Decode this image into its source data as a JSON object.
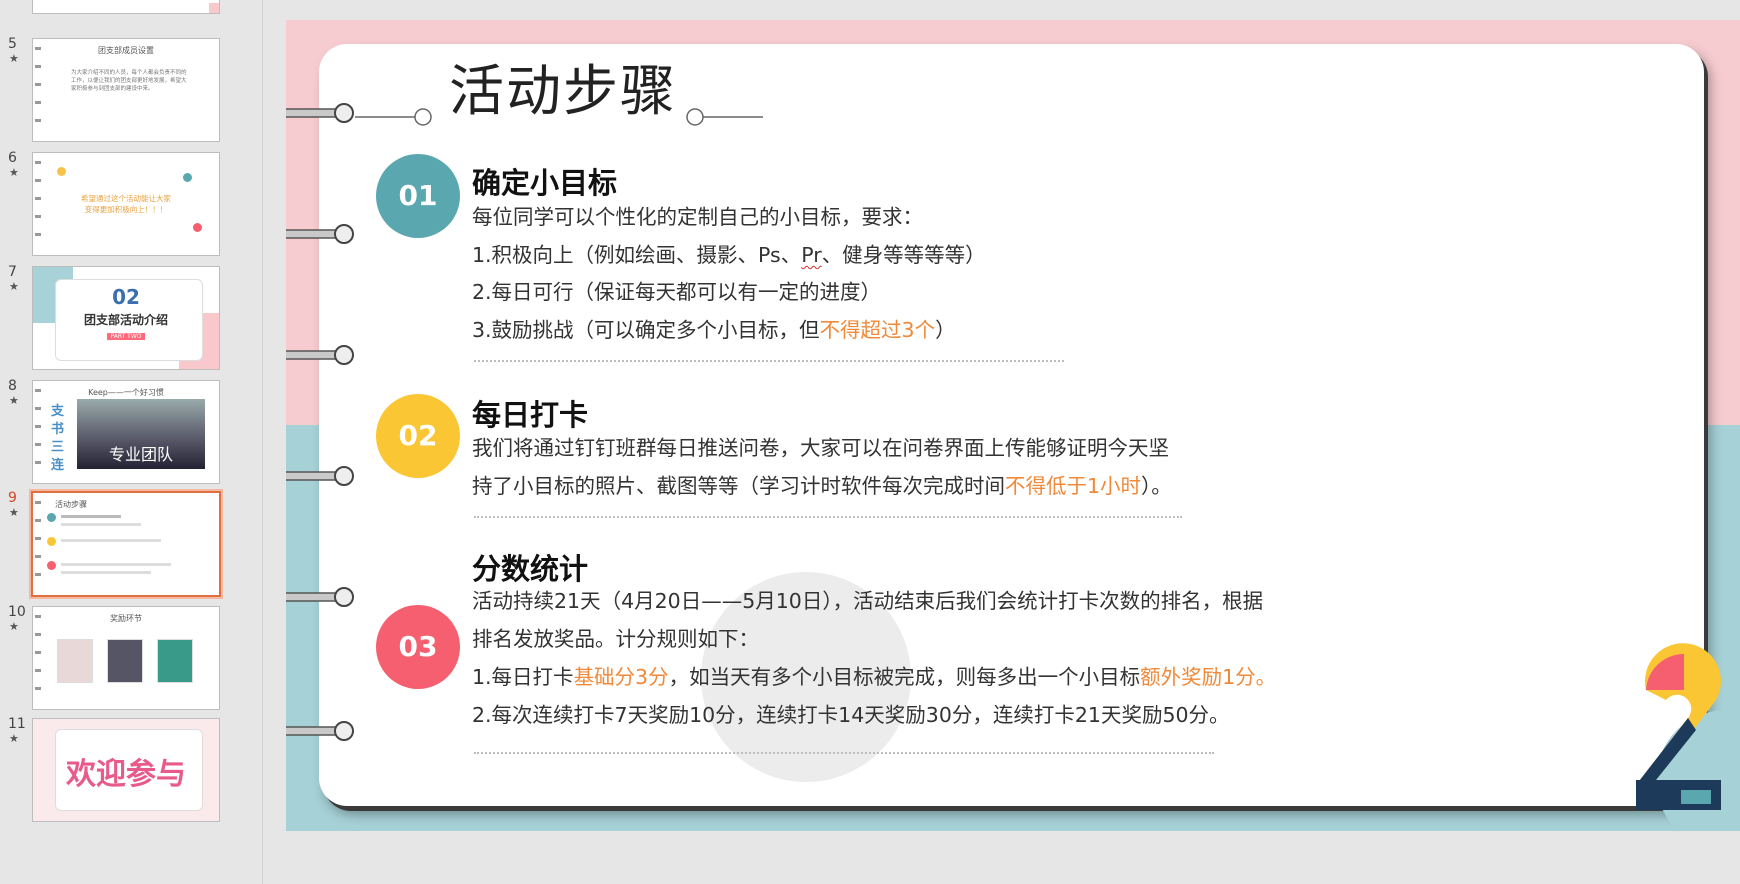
{
  "thumbnails": [
    {
      "number": "5",
      "title": "团支部成员设置",
      "body": "为大家介绍不同的人员，每个人都会负责不同的工作，以便让我们的团支部更好地发展，希望大家积极参与到团支部的建设中来。"
    },
    {
      "number": "6",
      "line1": "希望通过这个活动能让大家",
      "line2": "变得更加积极向上！！！"
    },
    {
      "number": "7",
      "big": "02",
      "title": "团支部活动介绍",
      "badge": "PART TWO"
    },
    {
      "number": "8",
      "title": "Keep——一个好习惯",
      "vertical": "支书三连",
      "caption": "专业团队"
    },
    {
      "number": "9",
      "title": "活动步骤",
      "active": true
    },
    {
      "number": "10",
      "title": "奖励环节"
    },
    {
      "number": "11",
      "title": "欢迎参与"
    }
  ],
  "slide": {
    "title": "活动步骤",
    "steps": [
      {
        "number": "01",
        "color": "#5aa7b0",
        "heading": "确定小目标",
        "lines": [
          {
            "text": "每位同学可以个性化的定制自己的小目标，要求："
          },
          {
            "pre": "1.积极向上（例如绘画、摄影、Ps、",
            "squiggle": "Pr",
            "post": "、健身等等等等）"
          },
          {
            "text": "2.每日可行（保证每天都可以有一定的进度）"
          },
          {
            "pre": "3.鼓励挑战（可以确定多个小目标，但",
            "hl": "不得超过3个",
            "post": "）"
          }
        ]
      },
      {
        "number": "02",
        "color": "#fbc634",
        "heading": "每日打卡",
        "lines": [
          {
            "text": "我们将通过钉钉班群每日推送问卷，大家可以在问卷界面上传能够证明今天坚"
          },
          {
            "pre": "持了小目标的照片、截图等等（学习计时软件每次完成时间",
            "hl": "不得低于1小时",
            "post": "）。"
          }
        ]
      },
      {
        "number": "03",
        "color": "#f55f6f",
        "heading": "分数统计",
        "lines": [
          {
            "text": "活动持续21天（4月20日——5月10日），活动结束后我们会统计打卡次数的排名，根据"
          },
          {
            "text": "排名发放奖品。计分规则如下："
          },
          {
            "pre": "1.每日打卡",
            "hl": "基础分3分",
            "mid": "，如当天有多个小目标被完成，则每多出一个小目标",
            "hl2": "额外奖励1分。"
          },
          {
            "text": "2.每次连续打卡7天奖励10分，连续打卡14天奖励30分，连续打卡21天奖励50分。"
          }
        ]
      }
    ]
  },
  "colors": {
    "pink_bg": "#f7ccd0",
    "teal_bg": "#a6d1d7",
    "highlight": "#f08a3a",
    "active_thumb_border": "#e07040"
  }
}
